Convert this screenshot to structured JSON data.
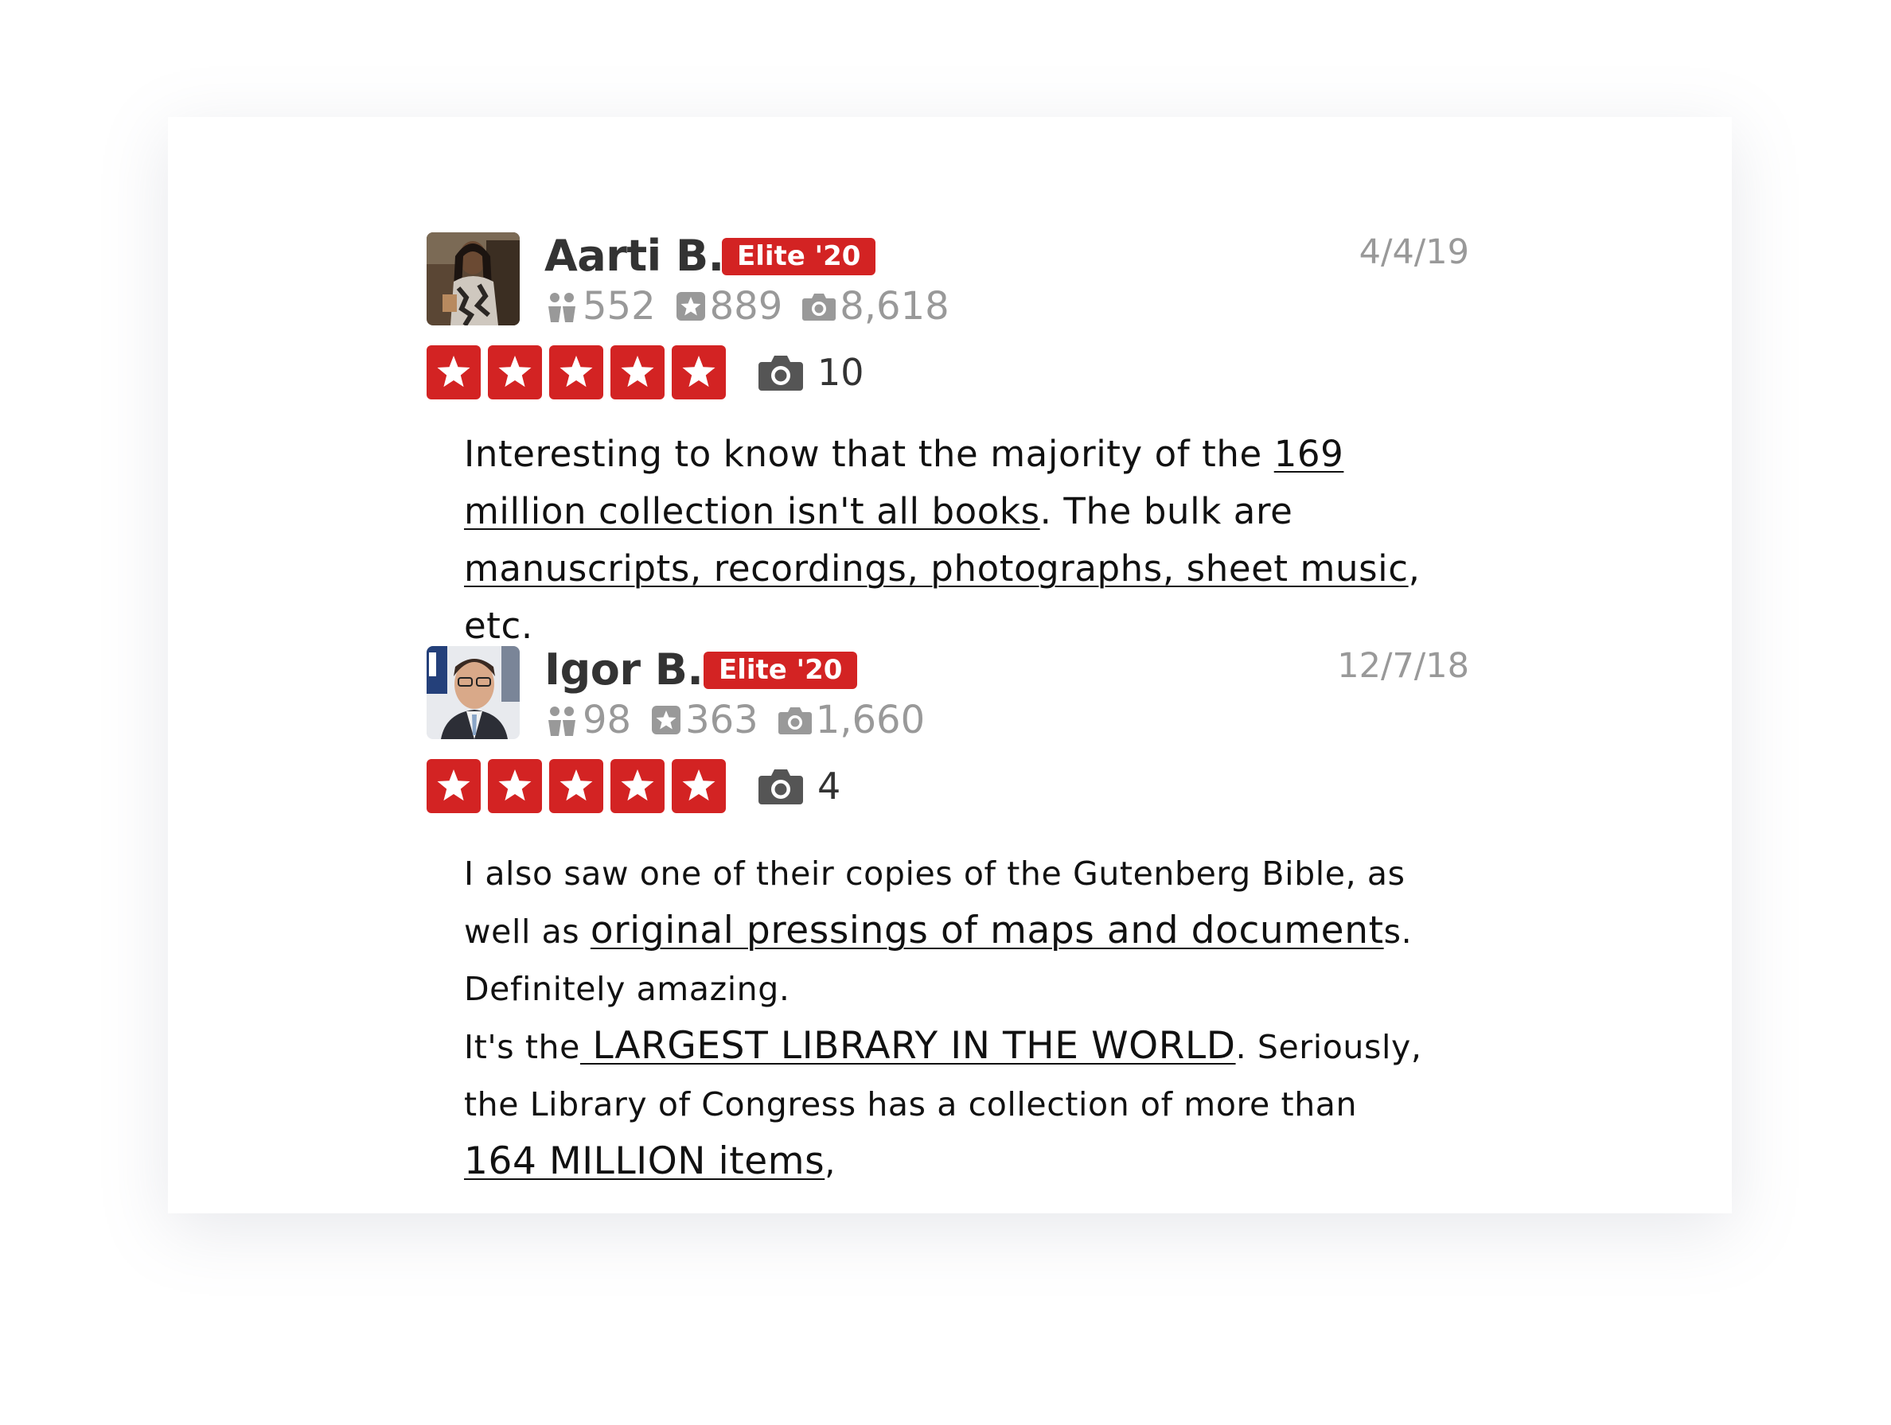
{
  "colors": {
    "brand_red": "#d32323",
    "meta_gray": "#999999",
    "text_dark": "#333333"
  },
  "reviews": [
    {
      "user_name": "Aarti B.",
      "elite_badge": "Elite '20",
      "date": "4/4/19",
      "friends_count": "552",
      "reviews_count": "889",
      "photos_count": "8,618",
      "rating": 5,
      "review_photos": "10",
      "text": {
        "p1": "Interesting to know that the majority of the ",
        "link1": "169 million collection isn't all books",
        "p2": ". The bulk are ",
        "link2": "manuscripts, recordings, photographs, sheet music",
        "p3": ", etc."
      }
    },
    {
      "user_name": "Igor B.",
      "elite_badge": "Elite '20",
      "date": "12/7/18",
      "friends_count": "98",
      "reviews_count": "363",
      "photos_count": "1,660",
      "rating": 5,
      "review_photos": "4",
      "text": {
        "p1": "I also saw one of their copies of the Gutenberg Bible, as well as ",
        "link1": "original pressings of maps and document",
        "p2": "s. Definitely amazing.",
        "p3": "It's the",
        "link2": " LARGEST LIBRARY IN THE WORLD",
        "p4": ". Seriously, the Library of Congress has a collection of more than ",
        "link3": "164 MILLION items",
        "p5": ","
      }
    }
  ]
}
